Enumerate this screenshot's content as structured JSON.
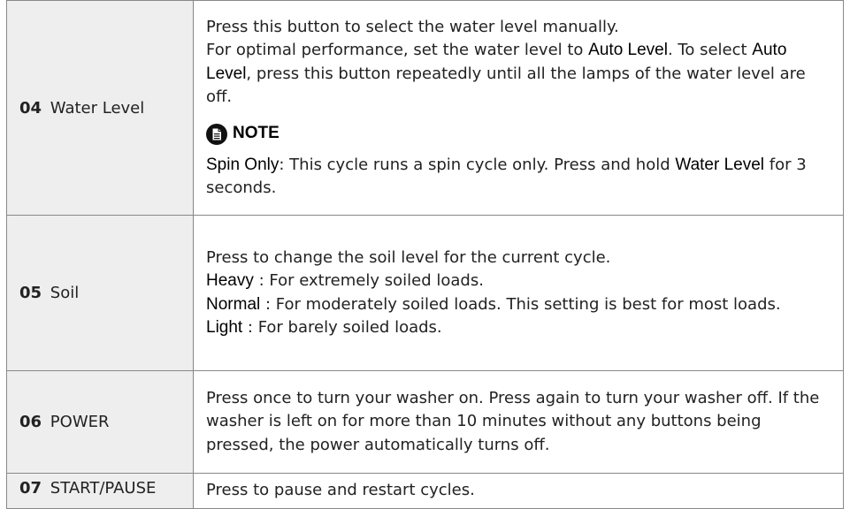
{
  "rows": [
    {
      "num": "04",
      "label": "Water Level",
      "lines": [
        "Press this button to select the water level manually."
      ],
      "para2_a": "For optimal performance, set the water level to ",
      "para2_kw1": "Auto Level",
      "para2_b": ". To select ",
      "para2_kw2": "Auto Level",
      "para2_c": ", press this button repeatedly until all the lamps of the water level are off.",
      "note_title": "NOTE",
      "note_kw1": "Spin Only",
      "note_a": ": This cycle runs a spin cycle only. Press and hold ",
      "note_kw2": "Water Level",
      "note_b": " for 3 seconds."
    },
    {
      "num": "05",
      "label": "Soil",
      "intro": "Press to change the soil level for the current cycle.",
      "items": [
        {
          "kw": "Heavy",
          "text": " : For extremely soiled loads."
        },
        {
          "kw": "Normal",
          "text": " : For moderately soiled loads. This setting is best for most loads."
        },
        {
          "kw": "Light",
          "text": " : For barely soiled loads."
        }
      ]
    },
    {
      "num": "06",
      "label": "POWER",
      "text": "Press once to turn your washer on. Press again to turn your washer off. If the washer is left on for more than 10 minutes without any buttons being pressed, the power automatically turns off."
    },
    {
      "num": "07",
      "label": "START/PAUSE",
      "text": "Press to pause and restart cycles."
    }
  ],
  "icons": {
    "note": "note-document-icon"
  }
}
